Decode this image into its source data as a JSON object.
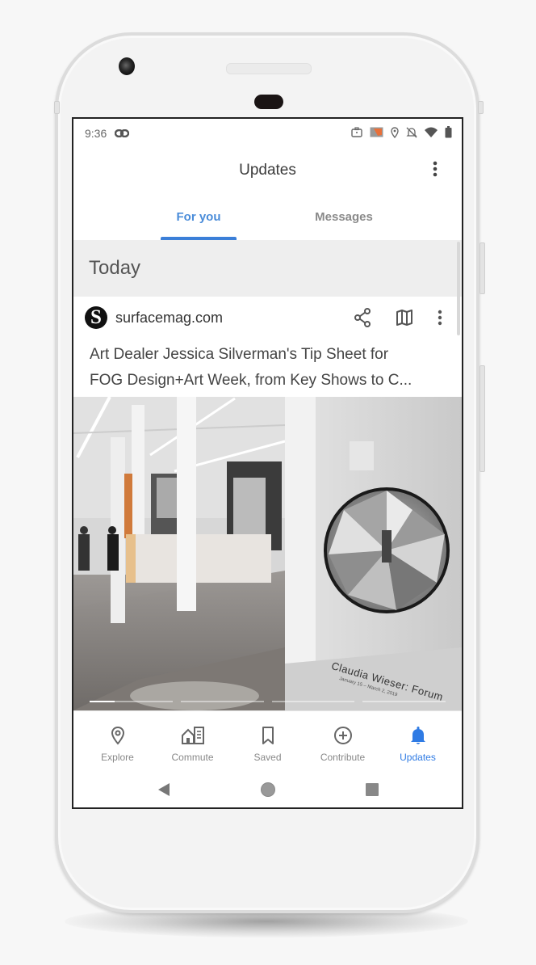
{
  "status_bar": {
    "time": "9:36",
    "left_icons": [
      "link-icon"
    ],
    "right_icons": [
      "briefcase-icon",
      "cast-icon",
      "location-icon",
      "notifications-off-icon",
      "wifi-icon",
      "battery-icon"
    ]
  },
  "app_bar": {
    "title": "Updates",
    "menu_icon": "more-vert-icon"
  },
  "tabs": [
    {
      "label": "For you",
      "active": true
    },
    {
      "label": "Messages",
      "active": false
    }
  ],
  "feed": {
    "section_title": "Today",
    "card": {
      "source_logo_letter": "S",
      "source": "surfacemag.com",
      "actions": [
        "share-icon",
        "map-icon",
        "more-vert-icon"
      ],
      "headline_line1": "Art Dealer Jessica Silverman's Tip Sheet for",
      "headline_line2": "FOG Design+Art Week, from Key Shows to C...",
      "image_caption": "Claudia Wieser: Forum",
      "image_caption_sub": "January 15 – March 2, 2019",
      "slideshow": {
        "slides": 4,
        "current": 1,
        "current_progress": 0.3
      }
    }
  },
  "bottom_nav": [
    {
      "label": "Explore",
      "icon": "location-pin-icon",
      "active": false
    },
    {
      "label": "Commute",
      "icon": "commute-icon",
      "active": false
    },
    {
      "label": "Saved",
      "icon": "bookmark-icon",
      "active": false
    },
    {
      "label": "Contribute",
      "icon": "add-circle-icon",
      "active": false
    },
    {
      "label": "Updates",
      "icon": "bell-icon",
      "active": true
    }
  ],
  "system_nav": [
    "back-button",
    "home-button",
    "recents-button"
  ],
  "colors": {
    "accent": "#3b7fd8",
    "tab_active_text": "#4a8cd9",
    "inactive_text": "#888888",
    "section_bg": "#eeeeee",
    "cast_orange": "#e8703a"
  }
}
